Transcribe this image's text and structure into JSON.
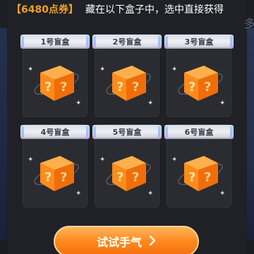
{
  "header": {
    "points_label": "【6480点券】",
    "subtitle": "藏在以下盒子中，选中直接获得"
  },
  "boxes": [
    {
      "label": "1号盲盒"
    },
    {
      "label": "2号盲盒"
    },
    {
      "label": "3号盲盒"
    },
    {
      "label": "4号盲盒"
    },
    {
      "label": "5号盲盒"
    },
    {
      "label": "6号盲盒"
    }
  ],
  "action": {
    "button_label": "试试手气",
    "button_icon": "chevron-right-icon"
  },
  "colors": {
    "accent": "#f0a020",
    "button": "#ff8a1e",
    "box_orange": "#ff8c1a"
  },
  "right_edge_glyph": "多"
}
